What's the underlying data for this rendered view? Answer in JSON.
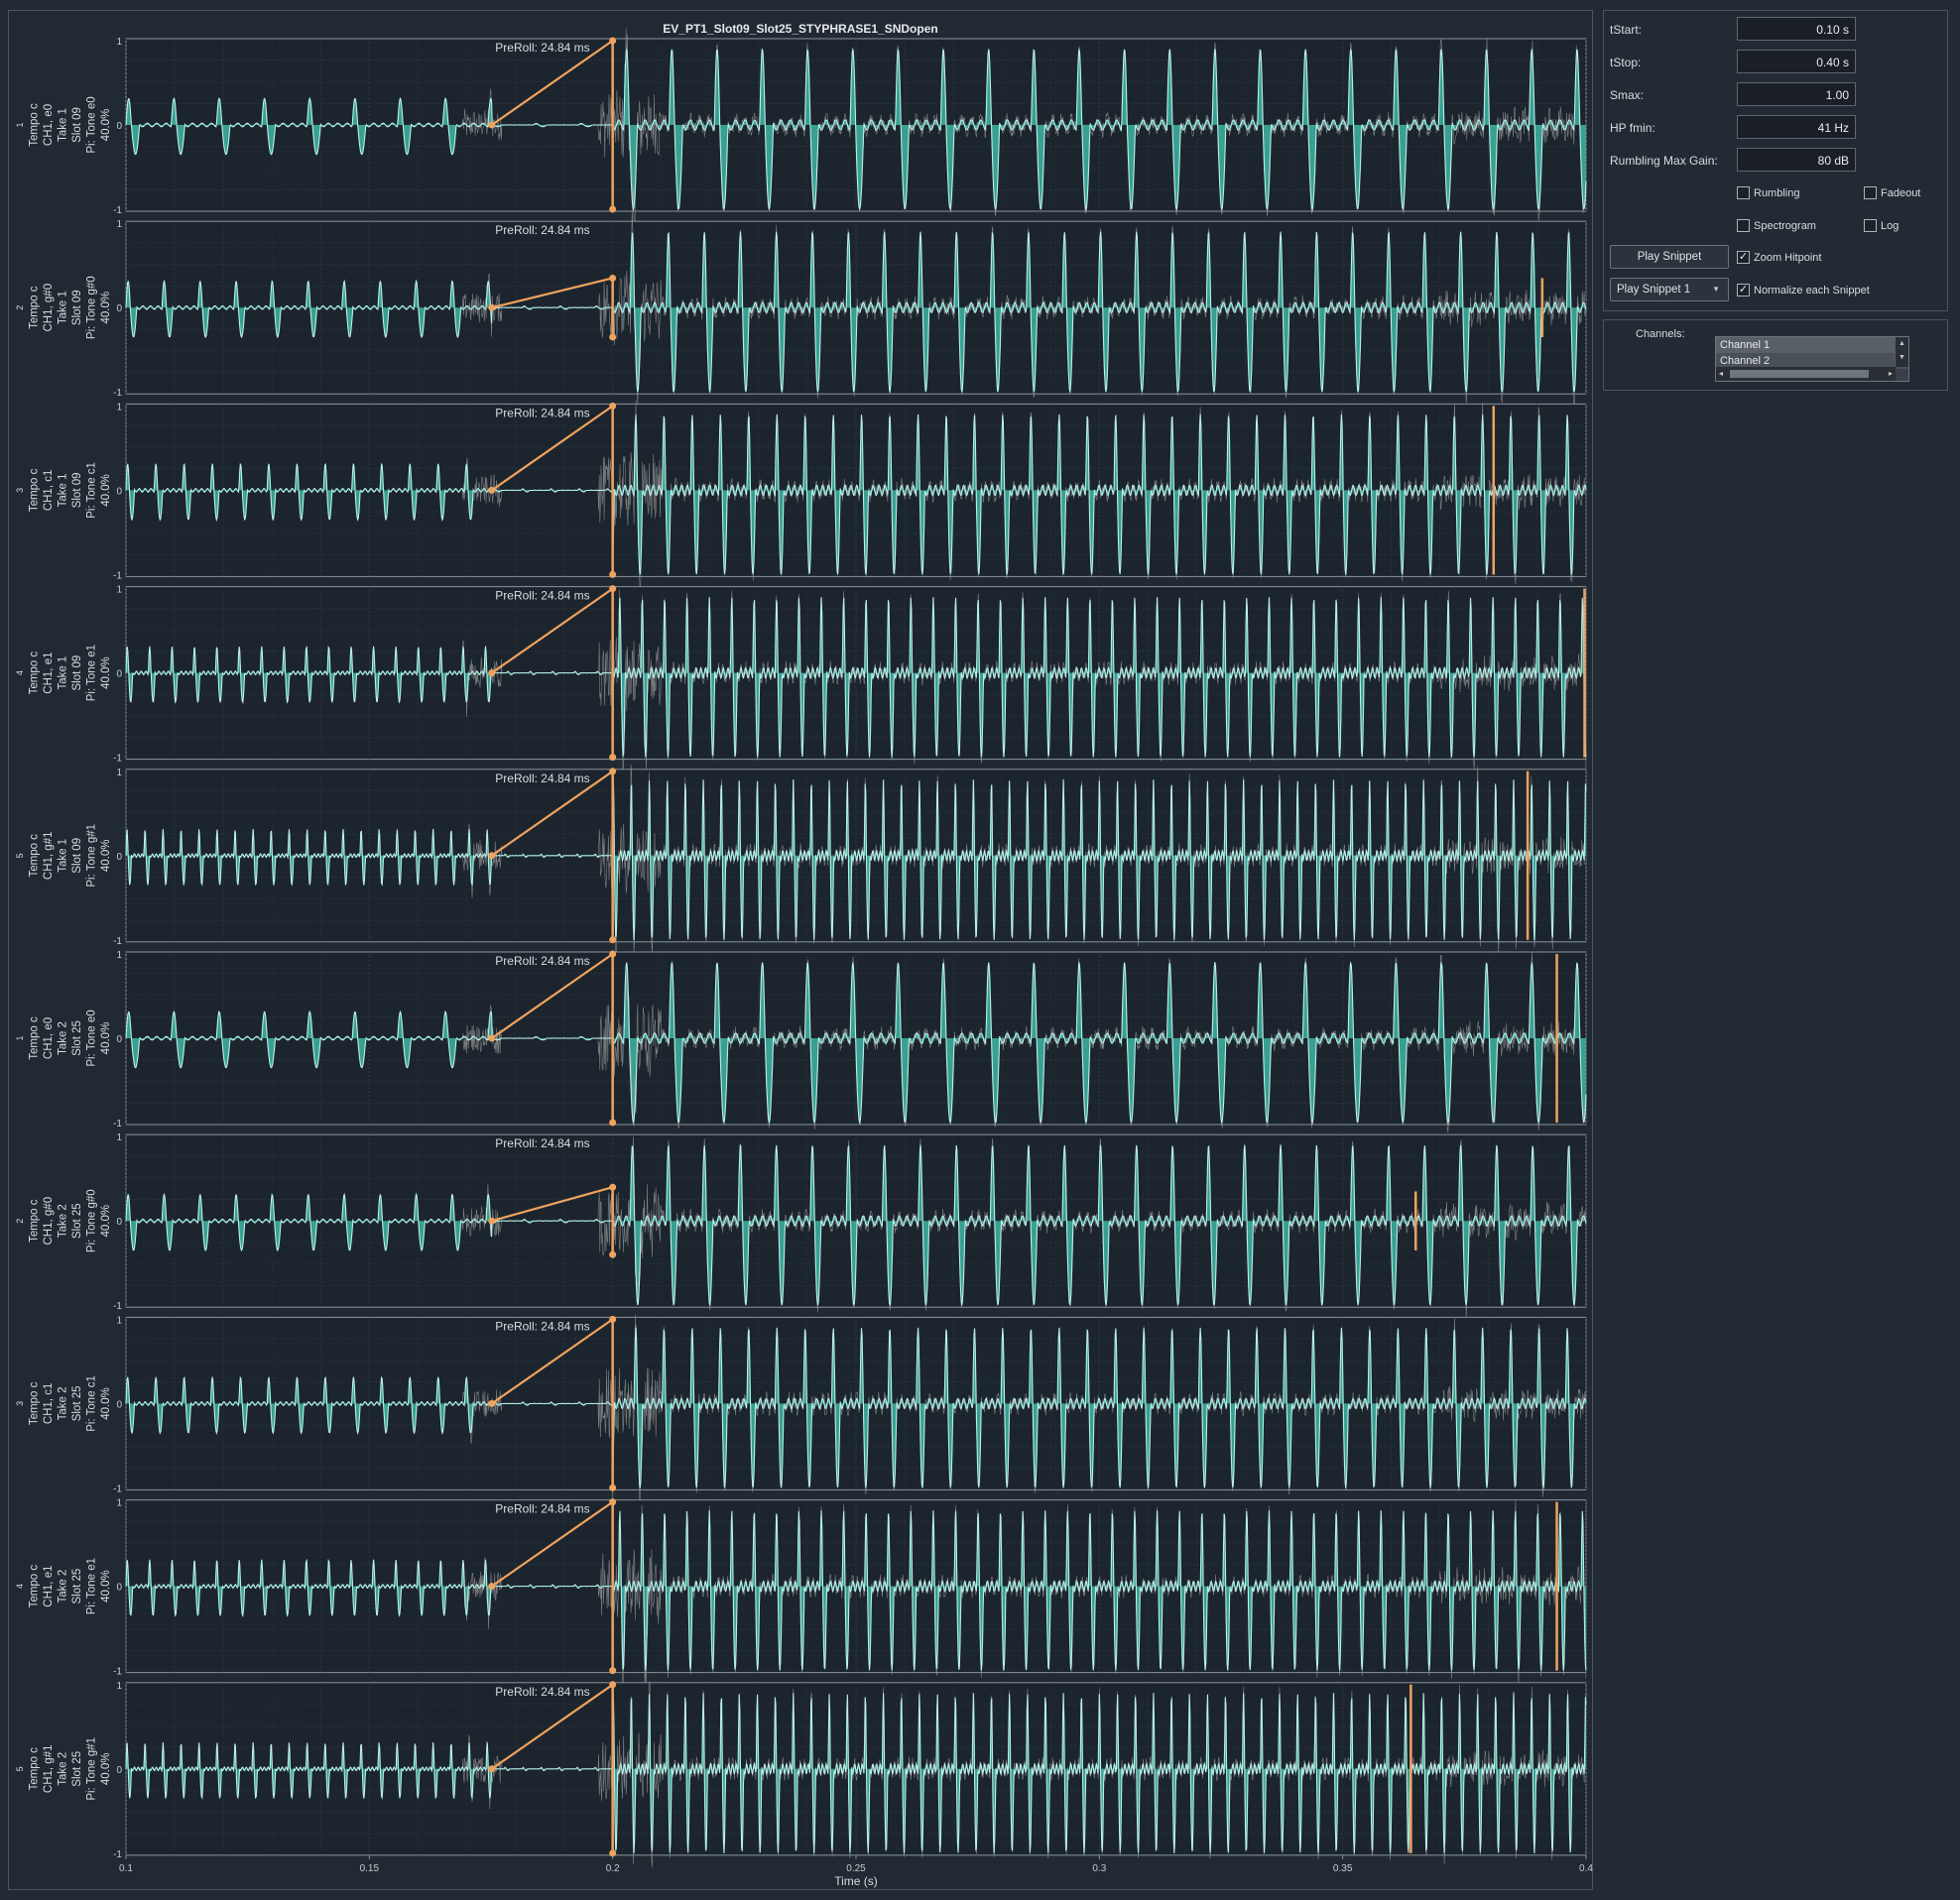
{
  "figure": {
    "title": "EV_PT1_Slot09_Slot25_STYPHRASE1_SNDopen",
    "xlabel": "Time (s)",
    "preroll_label": "PreRoll: 24.84 ms"
  },
  "controls": {
    "tstart_label": "tStart:",
    "tstart_value": "0.10 s",
    "tstop_label": "tStop:",
    "tstop_value": "0.40 s",
    "smax_label": "Smax:",
    "smax_value": "1.00",
    "hpfmin_label": "HP fmin:",
    "hpfmin_value": "41 Hz",
    "rumbling_gain_label": "Rumbling Max Gain:",
    "rumbling_gain_value": "80 dB",
    "rumbling": {
      "label": "Rumbling",
      "checked": false
    },
    "fadeout": {
      "label": "Fadeout",
      "checked": false
    },
    "spectrogram": {
      "label": "Spectrogram",
      "checked": false
    },
    "log": {
      "label": "Log",
      "checked": false
    },
    "zoom_hitpoint": {
      "label": "Zoom Hitpoint",
      "checked": true
    },
    "normalize": {
      "label": "Normalize each Snippet",
      "checked": true
    },
    "play_snippet_button": "Play Snippet",
    "play_snippet_select": "Play Snippet 1",
    "channels_label": "Channels:",
    "channels": [
      "Channel 1",
      "Channel 2"
    ]
  },
  "colors": {
    "signal": "#3fb5a6",
    "signal_line": "#b8f0e8",
    "noise": "#9a9a9a",
    "marker": "#f0a35e",
    "axes_bg": "#1c252d",
    "grid": "#33414c"
  },
  "chart_data": {
    "type": "line",
    "xlim": [
      0.1,
      0.4
    ],
    "ylim": [
      -1,
      1
    ],
    "x_ticks": [
      "0.1",
      "0.15",
      "0.2",
      "0.25",
      "0.3",
      "0.35",
      "0.4"
    ],
    "y_ticks": [
      "1",
      "0",
      "-1"
    ],
    "preroll_ms": 24.84,
    "trigger_time": 0.2,
    "panels": [
      {
        "index": "1",
        "tempo": "Tempo c",
        "channel": "CH1, e0",
        "take": "Take 1",
        "slot": "Slot 09",
        "pitch": "Pi: Tone e0",
        "level": "40.0%",
        "period_s": 0.0093,
        "preroll_peak": 1.0,
        "end_marker": null
      },
      {
        "index": "2",
        "tempo": "Tempo c",
        "channel": "CH1, g#0",
        "take": "Take 1",
        "slot": "Slot 09",
        "pitch": "Pi: Tone g#0",
        "level": "40.0%",
        "period_s": 0.0074,
        "preroll_peak": 0.35,
        "end_marker": 0.391
      },
      {
        "index": "3",
        "tempo": "Tempo c",
        "channel": "CH1, c1",
        "take": "Take 1",
        "slot": "Slot 09",
        "pitch": "Pi: Tone c1",
        "level": "40.0%",
        "period_s": 0.0058,
        "preroll_peak": 1.0,
        "end_marker": 0.381
      },
      {
        "index": "4",
        "tempo": "Tempo c",
        "channel": "CH1, e1",
        "take": "Take 1",
        "slot": "Slot 09",
        "pitch": "Pi: Tone e1",
        "level": "40.0%",
        "period_s": 0.0046,
        "preroll_peak": 1.0,
        "end_marker": 0.4
      },
      {
        "index": "5",
        "tempo": "Tempo c",
        "channel": "CH1, g#1",
        "take": "Take 1",
        "slot": "Slot 09",
        "pitch": "Pi: Tone g#1",
        "level": "40.0%",
        "period_s": 0.0037,
        "preroll_peak": 1.0,
        "end_marker": 0.388
      },
      {
        "index": "1",
        "tempo": "Tempo c",
        "channel": "CH1, e0",
        "take": "Take 2",
        "slot": "Slot 25",
        "pitch": "Pi: Tone e0",
        "level": "40.0%",
        "period_s": 0.0093,
        "preroll_peak": 1.0,
        "end_marker": 0.394
      },
      {
        "index": "2",
        "tempo": "Tempo c",
        "channel": "CH1, g#0",
        "take": "Take 2",
        "slot": "Slot 25",
        "pitch": "Pi: Tone g#0",
        "level": "40.0%",
        "period_s": 0.0074,
        "preroll_peak": 0.4,
        "end_marker": 0.365
      },
      {
        "index": "3",
        "tempo": "Tempo c",
        "channel": "CH1, c1",
        "take": "Take 2",
        "slot": "Slot 25",
        "pitch": "Pi: Tone c1",
        "level": "40.0%",
        "period_s": 0.0058,
        "preroll_peak": 1.0,
        "end_marker": null
      },
      {
        "index": "4",
        "tempo": "Tempo c",
        "channel": "CH1, e1",
        "take": "Take 2",
        "slot": "Slot 25",
        "pitch": "Pi: Tone e1",
        "level": "40.0%",
        "period_s": 0.0046,
        "preroll_peak": 1.0,
        "end_marker": 0.394
      },
      {
        "index": "5",
        "tempo": "Tempo c",
        "channel": "CH1, g#1",
        "take": "Take 2",
        "slot": "Slot 25",
        "pitch": "Pi: Tone g#1",
        "level": "40.0%",
        "period_s": 0.0037,
        "preroll_peak": 1.0,
        "end_marker": 0.364
      }
    ]
  }
}
